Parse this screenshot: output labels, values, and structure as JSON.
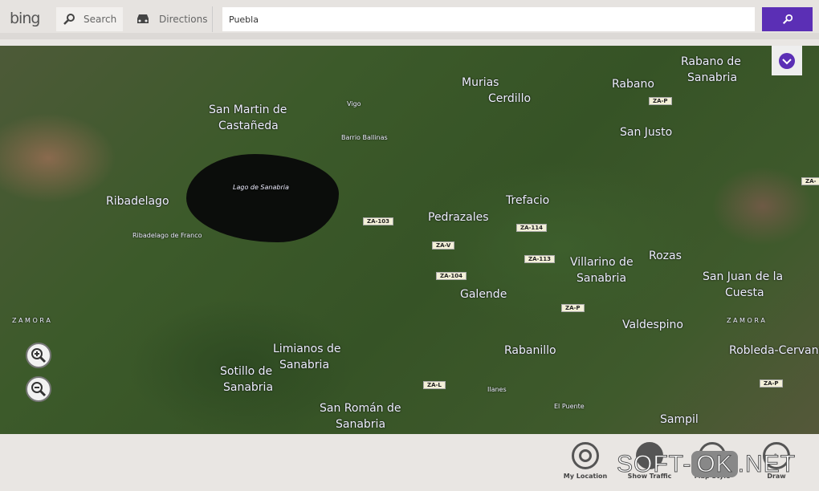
{
  "header": {
    "logo": "bing",
    "search_label": "Search",
    "directions_label": "Directions",
    "search_value": "Puebla"
  },
  "map": {
    "places": [
      {
        "t": "Rabano",
        "c": "big"
      },
      {
        "t": "Rabano de",
        "c": "big"
      },
      {
        "t": "Sanabria",
        "c": "big"
      },
      {
        "t": "Murias",
        "c": "big"
      },
      {
        "t": "Cerdillo",
        "c": "big"
      },
      {
        "t": "San Martin de",
        "c": "big"
      },
      {
        "t": "Castañeda",
        "c": "big"
      },
      {
        "t": "Vigo",
        "c": "sm"
      },
      {
        "t": "Barrio Ballinas",
        "c": "sm"
      },
      {
        "t": "San Justo",
        "c": "big"
      },
      {
        "t": "Lago de Sanabria",
        "c": "sm it"
      },
      {
        "t": "Ribadelago",
        "c": "big"
      },
      {
        "t": "Ribadelago de Franco",
        "c": "sm"
      },
      {
        "t": "Pedrazales",
        "c": "big"
      },
      {
        "t": "Trefacio",
        "c": "big"
      },
      {
        "t": "Villarino de",
        "c": "big"
      },
      {
        "t": "Sanabria",
        "c": "big"
      },
      {
        "t": "Rozas",
        "c": "big"
      },
      {
        "t": "San Juan de la",
        "c": "big"
      },
      {
        "t": "Cuesta",
        "c": "big"
      },
      {
        "t": "Galende",
        "c": "big"
      },
      {
        "t": "Z A M O R A",
        "c": "sm"
      },
      {
        "t": "Valdespino",
        "c": "big"
      },
      {
        "t": "Z A M O R A",
        "c": "sm"
      },
      {
        "t": "Limianos de",
        "c": "big"
      },
      {
        "t": "Sanabria",
        "c": "big"
      },
      {
        "t": "Rabanillo",
        "c": "big"
      },
      {
        "t": "Robleda-Cervantes",
        "c": "big"
      },
      {
        "t": "Sotillo de",
        "c": "big"
      },
      {
        "t": "Sanabria",
        "c": "big"
      },
      {
        "t": "San Román de",
        "c": "big"
      },
      {
        "t": "Sanabria",
        "c": "big"
      },
      {
        "t": "Ilanes",
        "c": "sm"
      },
      {
        "t": "El Puente",
        "c": "sm"
      },
      {
        "t": "Sampil",
        "c": "big"
      }
    ],
    "roads": [
      "ZA-P",
      "ZA-103",
      "ZA-V",
      "ZA-114",
      "ZA-113",
      "ZA-104",
      "ZA-P",
      "ZA-L",
      "ZA-P",
      "ZA-"
    ]
  },
  "bottom": {
    "actions": [
      "My Location",
      "Show Traffic",
      "Map Style",
      "Draw"
    ]
  },
  "watermark": "SOFT-OK.NET",
  "colors": {
    "accent": "#5b2fb5"
  }
}
